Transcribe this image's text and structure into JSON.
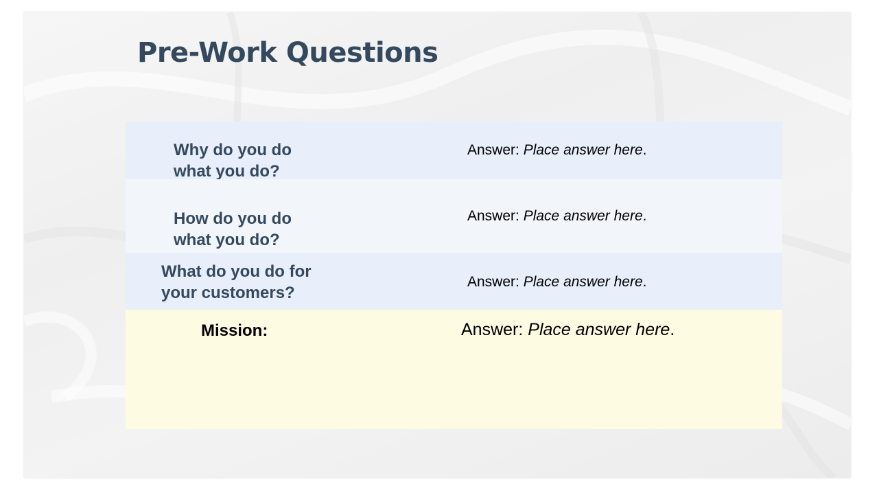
{
  "slide": {
    "title": "Pre-Work Questions"
  },
  "rows": [
    {
      "question_line1": "Why do you do",
      "question_line2": "what you do?",
      "answer_label": "Answer: ",
      "answer_placeholder": "Place answer here",
      "answer_end": "."
    },
    {
      "question_line1": "How do you do",
      "question_line2": "what you do?",
      "answer_label": "Answer: ",
      "answer_placeholder": "Place answer here",
      "answer_end": "."
    },
    {
      "question_line1": "What do you do for",
      "question_line2": "your customers?",
      "answer_label": "Answer: ",
      "answer_placeholder": "Place answer here",
      "answer_end": "."
    }
  ],
  "mission": {
    "label": "Mission:",
    "answer_label": "Answer: ",
    "answer_placeholder": "Place answer here",
    "answer_end": "."
  },
  "colors": {
    "title": "#34495e",
    "row_blue": "#e8eefa",
    "row_light": "#f2f6fb",
    "mission_bg": "#fefbe3"
  }
}
